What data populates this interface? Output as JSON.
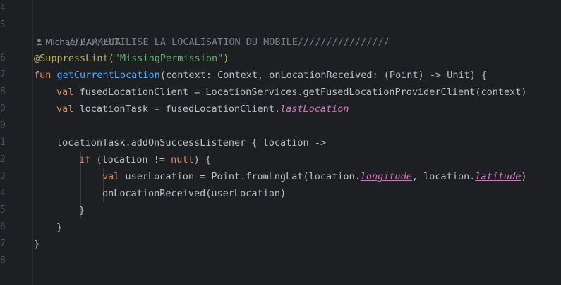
{
  "gutter": {
    "line_numbers": [
      "4",
      "5",
      "6",
      "7",
      "8",
      "9",
      "0",
      "1",
      "2",
      "3",
      "4",
      "5",
      "6",
      "7",
      "8"
    ]
  },
  "author": "Michael BARRECA",
  "code": {
    "l5": "///////UTILISE LA LOCALISATION DU MOBILE////////////////",
    "l6_annot": "@SuppressLint(",
    "l6_str": "\"MissingPermission\"",
    "l6_close": ")",
    "l7_kw": "fun ",
    "l7_fn": "getCurrentLocation",
    "l7_rest": "(context: Context, onLocationReceived: (Point) -> Unit) {",
    "l8_kw": "val ",
    "l8_rest": "fusedLocationClient = LocationServices.getFusedLocationProviderClient(context)",
    "l9_kw": "val ",
    "l9_rest": "locationTask = fusedLocationClient.",
    "l9_prop": "lastLocation",
    "l11": "locationTask.addOnSuccessListener { location ->",
    "l12_kw": "if ",
    "l12_a": "(location != ",
    "l12_null": "null",
    "l12_b": ") {",
    "l13_kw": "val ",
    "l13_a": "userLocation = Point.fromLngLat(location.",
    "l13_p1": "longitude",
    "l13_b": ", location.",
    "l13_p2": "latitude",
    "l13_c": ")",
    "l14": "onLocationReceived(userLocation)",
    "l15": "}",
    "l16": "}",
    "l17": "}"
  }
}
